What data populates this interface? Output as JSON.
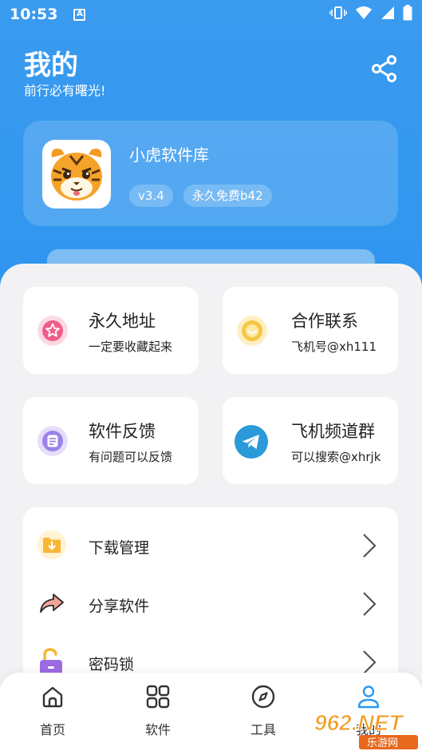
{
  "status_bar": {
    "time": "10:53",
    "indicator": "A"
  },
  "header": {
    "title": "我的",
    "subtitle": "前行必有曙光!"
  },
  "app_card": {
    "name": "小虎软件库",
    "version": "v3.4",
    "build": "永久免费b42"
  },
  "tiles": [
    {
      "title": "永久地址",
      "desc": "一定要收藏起来",
      "icon": "star-icon",
      "color": "#EF5E8A"
    },
    {
      "title": "合作联系",
      "desc": "飞机号@xh111",
      "icon": "smile-icon",
      "color": "#F7C744"
    },
    {
      "title": "软件反馈",
      "desc": "有问题可以反馈",
      "icon": "feedback-icon",
      "color": "#9A84E8"
    },
    {
      "title": "飞机频道群",
      "desc": "可以搜索@xhrjk",
      "icon": "telegram-icon",
      "color": "#2A9BD8"
    }
  ],
  "menu": [
    {
      "label": "下载管理",
      "icon": "download-folder-icon"
    },
    {
      "label": "分享软件",
      "icon": "share-arrow-icon"
    },
    {
      "label": "密码锁",
      "icon": "lock-icon"
    }
  ],
  "tabs": [
    {
      "label": "首页",
      "icon": "home-icon"
    },
    {
      "label": "软件",
      "icon": "grid-icon"
    },
    {
      "label": "工具",
      "icon": "compass-icon"
    },
    {
      "label": "我的",
      "icon": "user-icon"
    }
  ],
  "watermark": {
    "text": "962.NET",
    "subtext": "乐游网"
  },
  "colors": {
    "primary": "#2F97EE",
    "background": "#F2F2F4"
  }
}
